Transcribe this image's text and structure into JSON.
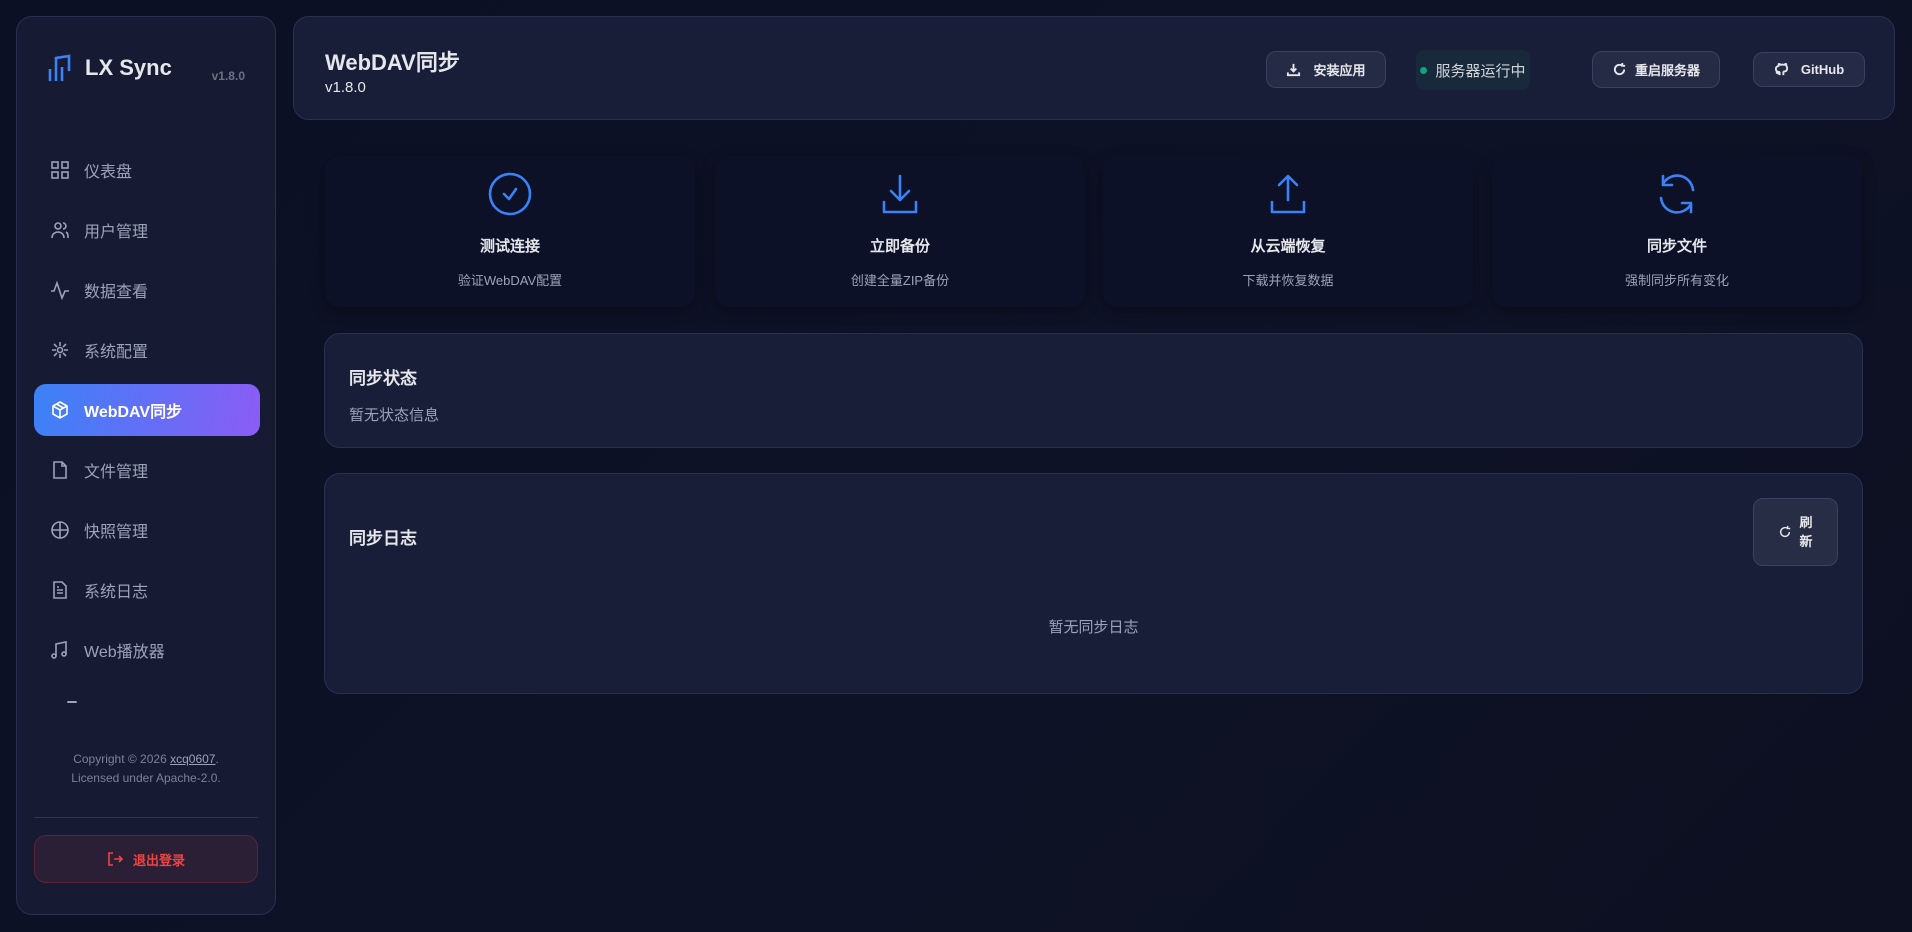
{
  "sidebar": {
    "app_name": "LX Sync",
    "version": "v1.8.0",
    "items": [
      {
        "label": "仪表盘",
        "icon": "grid-icon"
      },
      {
        "label": "用户管理",
        "icon": "users-icon"
      },
      {
        "label": "数据查看",
        "icon": "activity-icon"
      },
      {
        "label": "系统配置",
        "icon": "settings-icon"
      },
      {
        "label": "WebDAV同步",
        "icon": "box-icon",
        "active": true
      },
      {
        "label": "文件管理",
        "icon": "file-icon"
      },
      {
        "label": "快照管理",
        "icon": "snapshot-icon"
      },
      {
        "label": "系统日志",
        "icon": "log-icon"
      },
      {
        "label": "Web播放器",
        "icon": "music-icon"
      }
    ],
    "copyright_prefix": "Copyright © 2026 ",
    "copyright_author": "xcq0607",
    "copyright_suffix": ".",
    "license": "Licensed under Apache-2.0.",
    "logout": "退出登录"
  },
  "header": {
    "title": "WebDAV同步",
    "version": "v1.8.0",
    "install": "安装应用",
    "status": "服务器运行中",
    "restart": "重启服务器",
    "github": "GitHub"
  },
  "actions": [
    {
      "title": "测试连接",
      "desc": "验证WebDAV配置"
    },
    {
      "title": "立即备份",
      "desc": "创建全量ZIP备份"
    },
    {
      "title": "从云端恢复",
      "desc": "下载并恢复数据"
    },
    {
      "title": "同步文件",
      "desc": "强制同步所有变化"
    }
  ],
  "sync_status": {
    "title": "同步状态",
    "empty": "暂无状态信息"
  },
  "sync_log": {
    "title": "同步日志",
    "refresh_1": "刷",
    "refresh_2": "新",
    "empty": "暂无同步日志"
  },
  "colors": {
    "accent": "#3b82f6",
    "accent2": "#8b5cf6",
    "danger": "#ef4444",
    "online": "#10a37f"
  }
}
